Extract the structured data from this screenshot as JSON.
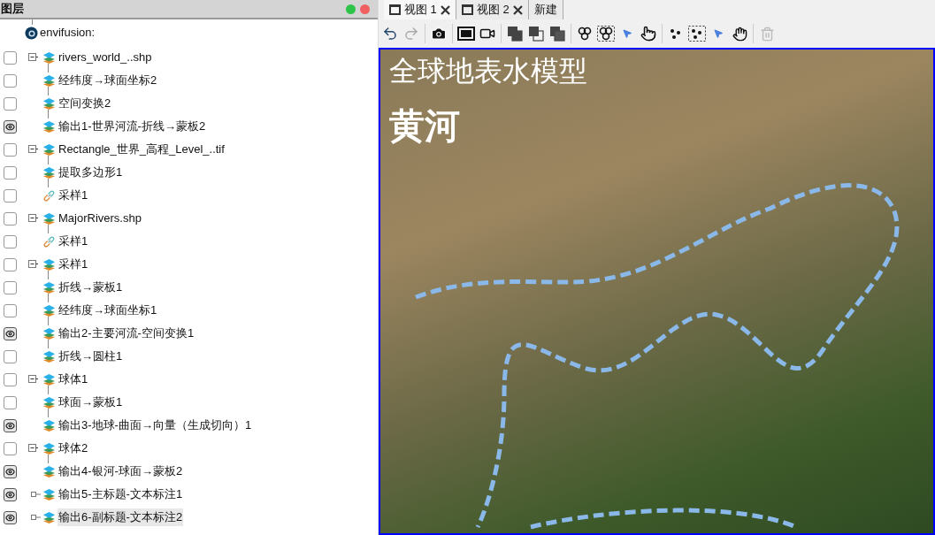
{
  "layers_panel": {
    "title": "图层",
    "root": {
      "label": "envifusion:",
      "children": [
        {
          "label": "rivers_world_..shp",
          "kind": "group",
          "visible": false,
          "selected": false,
          "children": [
            {
              "label": "经纬度→球面坐标2",
              "kind": "leaf",
              "visible": false,
              "selected": false
            },
            {
              "label": "空间变换2",
              "kind": "leaf",
              "visible": false,
              "selected": false
            },
            {
              "label": "输出1-世界河流-折线→蒙板2",
              "kind": "leaf",
              "visible": true,
              "selected": false
            }
          ]
        },
        {
          "label": "Rectangle_世界_高程_Level_..tif",
          "kind": "group",
          "visible": false,
          "selected": false,
          "children": [
            {
              "label": "提取多边形1",
              "kind": "leaf",
              "visible": false,
              "selected": false
            },
            {
              "label": "采样1",
              "kind": "link",
              "visible": false,
              "selected": false
            }
          ]
        },
        {
          "label": "MajorRivers.shp",
          "kind": "group",
          "visible": false,
          "selected": false,
          "children": [
            {
              "label": "采样1",
              "kind": "link",
              "visible": false,
              "selected": false
            }
          ]
        },
        {
          "label": "采样1",
          "kind": "group",
          "visible": false,
          "selected": false,
          "children": [
            {
              "label": "折线→蒙板1",
              "kind": "leaf",
              "visible": false,
              "selected": false
            },
            {
              "label": "经纬度→球面坐标1",
              "kind": "leaf",
              "visible": false,
              "selected": false
            },
            {
              "label": "输出2-主要河流-空间变换1",
              "kind": "leaf",
              "visible": true,
              "selected": false
            },
            {
              "label": "折线→圆柱1",
              "kind": "leaf",
              "visible": false,
              "selected": false
            }
          ]
        },
        {
          "label": "球体1",
          "kind": "group",
          "visible": false,
          "selected": false,
          "children": [
            {
              "label": "球面→蒙板1",
              "kind": "leaf",
              "visible": false,
              "selected": false
            },
            {
              "label": "输出3-地球-曲面→向量（生成切向）1",
              "kind": "leaf",
              "visible": true,
              "selected": false
            }
          ]
        },
        {
          "label": "球体2",
          "kind": "group",
          "visible": false,
          "selected": false,
          "children": [
            {
              "label": "输出4-银河-球面→蒙板2",
              "kind": "leaf",
              "visible": true,
              "selected": false
            }
          ]
        },
        {
          "label": "输出5-主标题-文本标注1",
          "kind": "single",
          "visible": true,
          "selected": false
        },
        {
          "label": "输出6-副标题-文本标注2",
          "kind": "single",
          "visible": true,
          "selected": true
        }
      ]
    }
  },
  "view_tabs": [
    {
      "label": "视图 1",
      "kind": "view",
      "selected": true
    },
    {
      "label": "视图 2",
      "kind": "view",
      "selected": false
    },
    {
      "label": "新建",
      "kind": "new",
      "selected": false
    }
  ],
  "viewport": {
    "title": "全球地表水模型",
    "subtitle": "黄河"
  }
}
